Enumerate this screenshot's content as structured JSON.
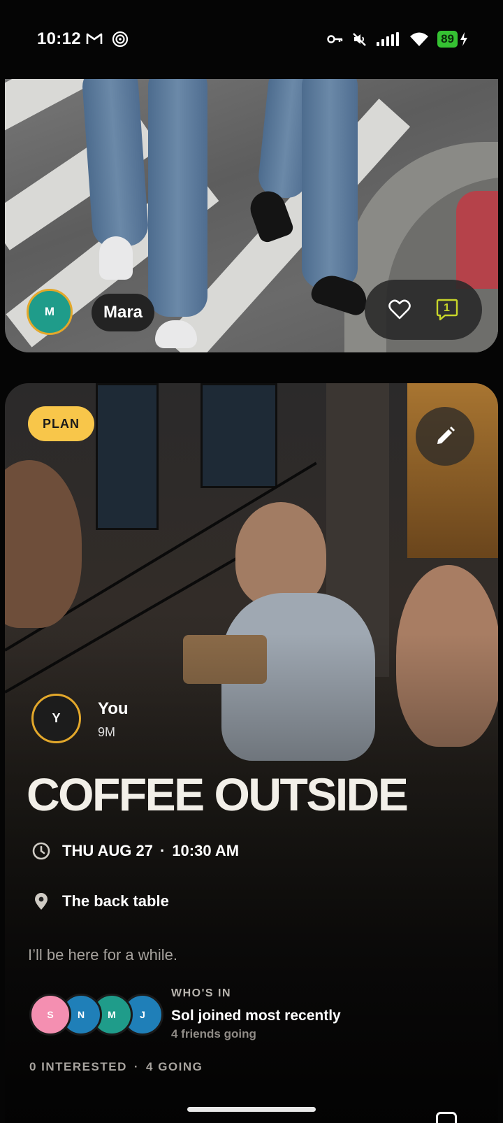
{
  "status_bar": {
    "time": "10:12",
    "battery": "89",
    "icons": [
      "gmail-icon",
      "hotspot-icon",
      "vpn-key-icon",
      "mute-icon",
      "signal-icon",
      "wifi-icon",
      "battery-icon"
    ]
  },
  "post": {
    "author_initial": "M",
    "author_name": "Mara",
    "comment_count": "1",
    "accent": "#e3a82b"
  },
  "plan": {
    "badge": "PLAN",
    "creator_initial": "Y",
    "creator_name": "You",
    "created_ago": "9M",
    "title": "COFFEE OUTSIDE",
    "date": "THU AUG 27",
    "time": "10:30 AM",
    "location": "The back table",
    "note": "I’ll be here for a while.",
    "whos_in_label": "WHO'S IN",
    "whos_in_headline": "Sol joined most recently",
    "whos_in_sub": "4 friends going",
    "interested": "0 INTERESTED",
    "going": "4 GOING",
    "badge_color": "#f8c64a",
    "attendees": [
      {
        "initial": "S",
        "color": "#f48fb1"
      },
      {
        "initial": "N",
        "color": "#1f7fb8"
      },
      {
        "initial": "M",
        "color": "#1f9c8a"
      },
      {
        "initial": "J",
        "color": "#1f7fb8"
      }
    ]
  }
}
